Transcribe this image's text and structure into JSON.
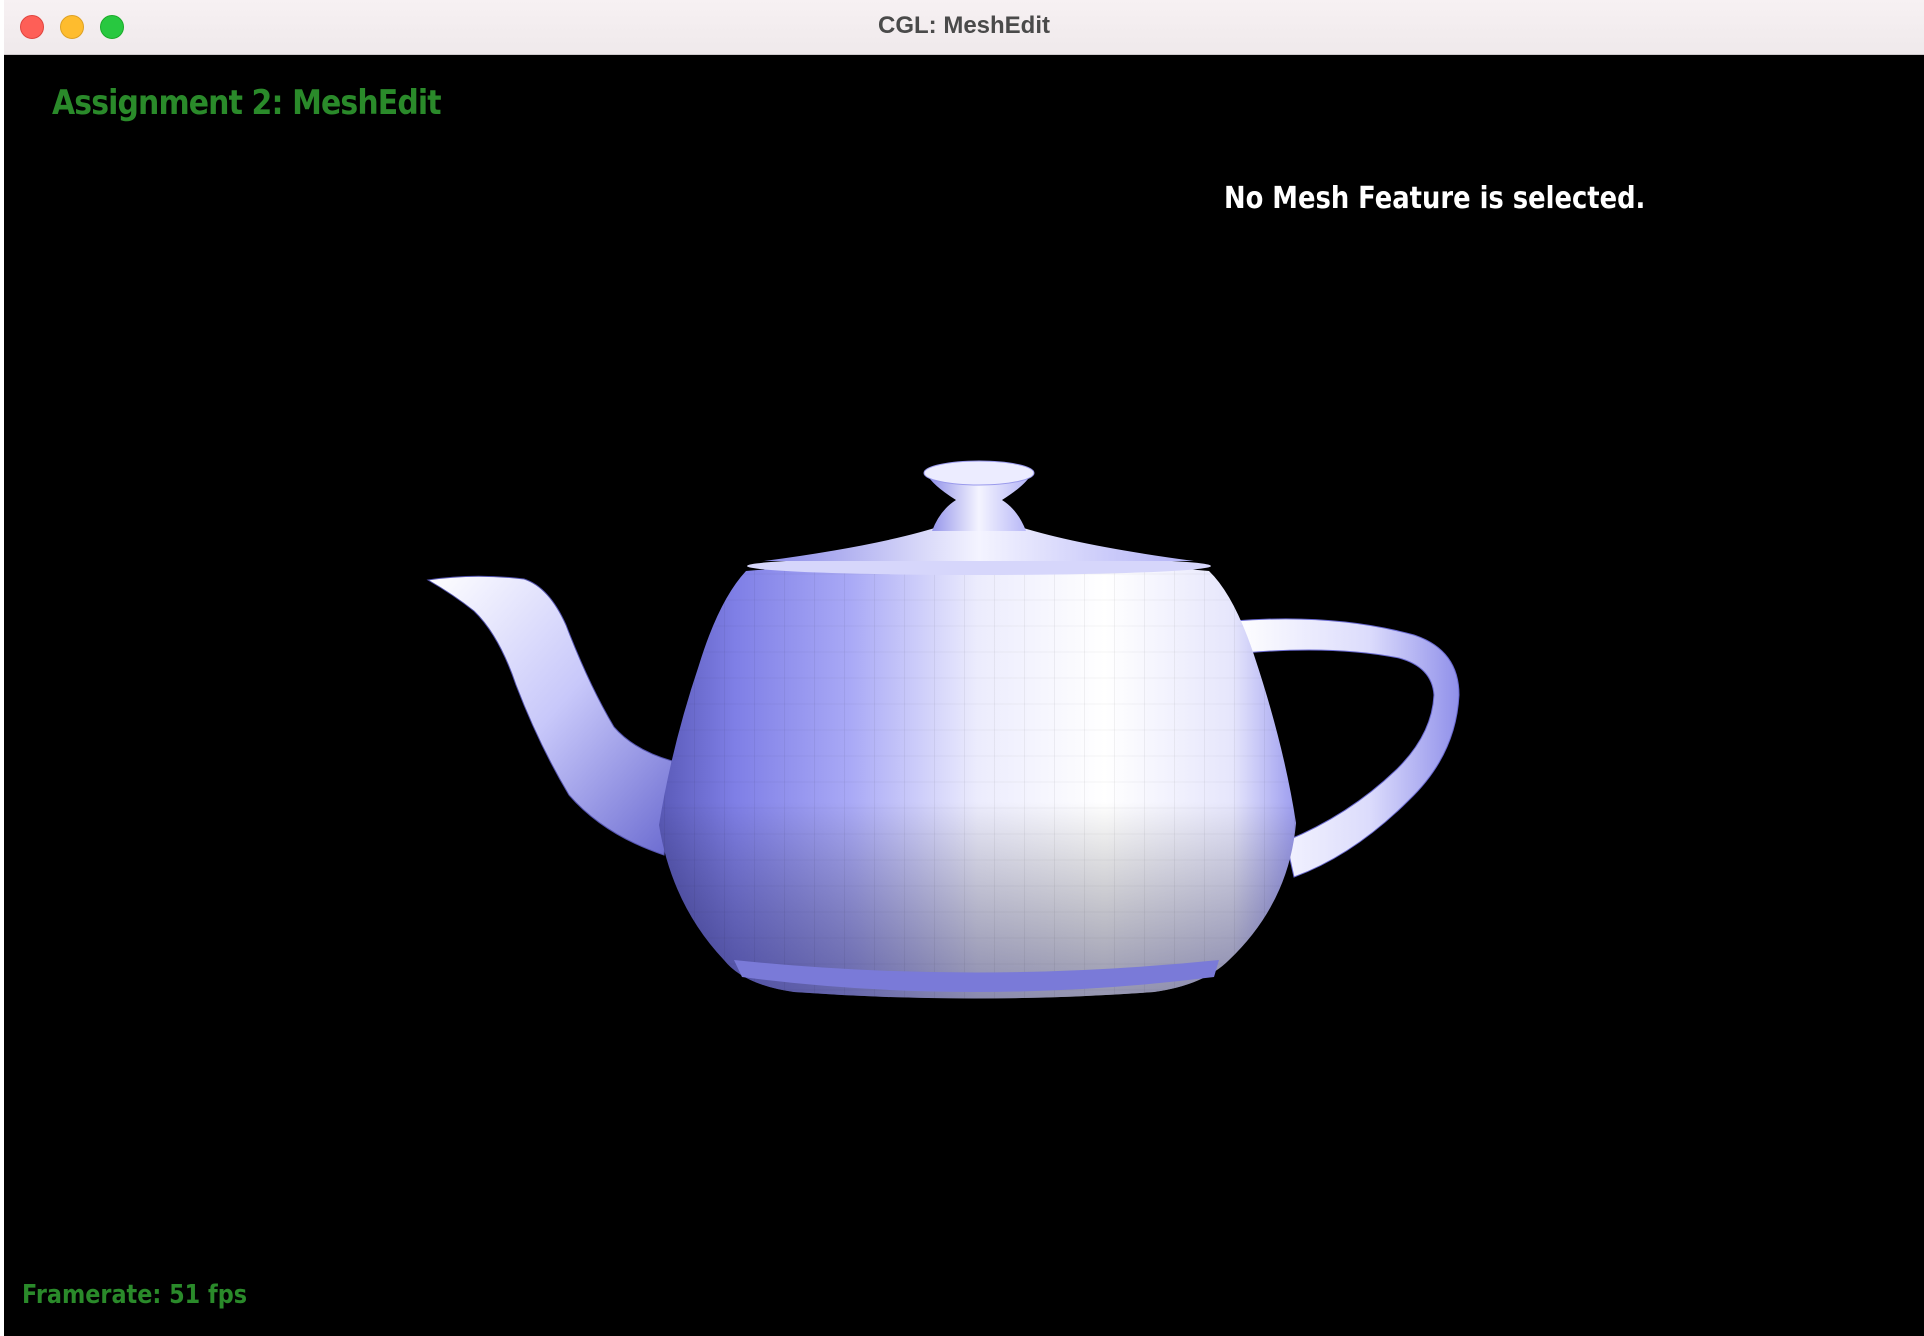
{
  "window": {
    "title": "CGL: MeshEdit"
  },
  "viewport": {
    "assignment_title": "Assignment 2: MeshEdit",
    "selection_status": "No Mesh Feature is selected.",
    "framerate": "Framerate: 51 fps",
    "mesh_color": "#8f8ff2",
    "title_color": "#2a8a2a"
  }
}
